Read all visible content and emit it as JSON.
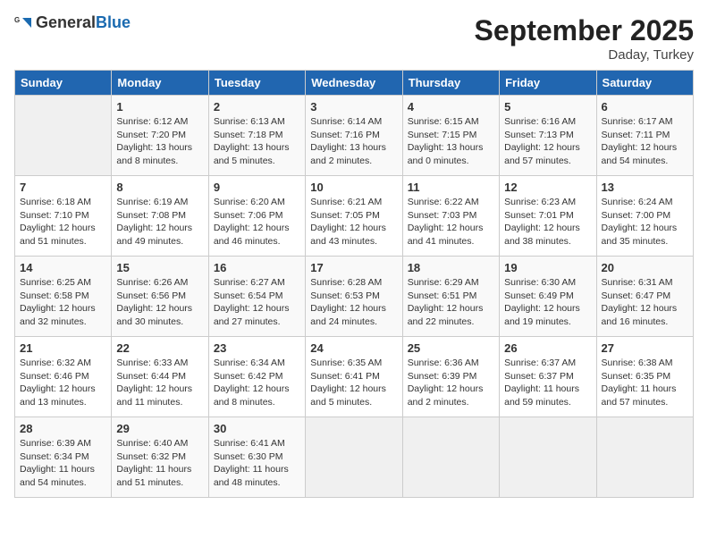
{
  "header": {
    "logo_general": "General",
    "logo_blue": "Blue",
    "month": "September 2025",
    "location": "Daday, Turkey"
  },
  "days": [
    "Sunday",
    "Monday",
    "Tuesday",
    "Wednesday",
    "Thursday",
    "Friday",
    "Saturday"
  ],
  "weeks": [
    [
      {
        "date": "",
        "info": ""
      },
      {
        "date": "1",
        "info": "Sunrise: 6:12 AM\nSunset: 7:20 PM\nDaylight: 13 hours\nand 8 minutes."
      },
      {
        "date": "2",
        "info": "Sunrise: 6:13 AM\nSunset: 7:18 PM\nDaylight: 13 hours\nand 5 minutes."
      },
      {
        "date": "3",
        "info": "Sunrise: 6:14 AM\nSunset: 7:16 PM\nDaylight: 13 hours\nand 2 minutes."
      },
      {
        "date": "4",
        "info": "Sunrise: 6:15 AM\nSunset: 7:15 PM\nDaylight: 13 hours\nand 0 minutes."
      },
      {
        "date": "5",
        "info": "Sunrise: 6:16 AM\nSunset: 7:13 PM\nDaylight: 12 hours\nand 57 minutes."
      },
      {
        "date": "6",
        "info": "Sunrise: 6:17 AM\nSunset: 7:11 PM\nDaylight: 12 hours\nand 54 minutes."
      }
    ],
    [
      {
        "date": "7",
        "info": "Sunrise: 6:18 AM\nSunset: 7:10 PM\nDaylight: 12 hours\nand 51 minutes."
      },
      {
        "date": "8",
        "info": "Sunrise: 6:19 AM\nSunset: 7:08 PM\nDaylight: 12 hours\nand 49 minutes."
      },
      {
        "date": "9",
        "info": "Sunrise: 6:20 AM\nSunset: 7:06 PM\nDaylight: 12 hours\nand 46 minutes."
      },
      {
        "date": "10",
        "info": "Sunrise: 6:21 AM\nSunset: 7:05 PM\nDaylight: 12 hours\nand 43 minutes."
      },
      {
        "date": "11",
        "info": "Sunrise: 6:22 AM\nSunset: 7:03 PM\nDaylight: 12 hours\nand 41 minutes."
      },
      {
        "date": "12",
        "info": "Sunrise: 6:23 AM\nSunset: 7:01 PM\nDaylight: 12 hours\nand 38 minutes."
      },
      {
        "date": "13",
        "info": "Sunrise: 6:24 AM\nSunset: 7:00 PM\nDaylight: 12 hours\nand 35 minutes."
      }
    ],
    [
      {
        "date": "14",
        "info": "Sunrise: 6:25 AM\nSunset: 6:58 PM\nDaylight: 12 hours\nand 32 minutes."
      },
      {
        "date": "15",
        "info": "Sunrise: 6:26 AM\nSunset: 6:56 PM\nDaylight: 12 hours\nand 30 minutes."
      },
      {
        "date": "16",
        "info": "Sunrise: 6:27 AM\nSunset: 6:54 PM\nDaylight: 12 hours\nand 27 minutes."
      },
      {
        "date": "17",
        "info": "Sunrise: 6:28 AM\nSunset: 6:53 PM\nDaylight: 12 hours\nand 24 minutes."
      },
      {
        "date": "18",
        "info": "Sunrise: 6:29 AM\nSunset: 6:51 PM\nDaylight: 12 hours\nand 22 minutes."
      },
      {
        "date": "19",
        "info": "Sunrise: 6:30 AM\nSunset: 6:49 PM\nDaylight: 12 hours\nand 19 minutes."
      },
      {
        "date": "20",
        "info": "Sunrise: 6:31 AM\nSunset: 6:47 PM\nDaylight: 12 hours\nand 16 minutes."
      }
    ],
    [
      {
        "date": "21",
        "info": "Sunrise: 6:32 AM\nSunset: 6:46 PM\nDaylight: 12 hours\nand 13 minutes."
      },
      {
        "date": "22",
        "info": "Sunrise: 6:33 AM\nSunset: 6:44 PM\nDaylight: 12 hours\nand 11 minutes."
      },
      {
        "date": "23",
        "info": "Sunrise: 6:34 AM\nSunset: 6:42 PM\nDaylight: 12 hours\nand 8 minutes."
      },
      {
        "date": "24",
        "info": "Sunrise: 6:35 AM\nSunset: 6:41 PM\nDaylight: 12 hours\nand 5 minutes."
      },
      {
        "date": "25",
        "info": "Sunrise: 6:36 AM\nSunset: 6:39 PM\nDaylight: 12 hours\nand 2 minutes."
      },
      {
        "date": "26",
        "info": "Sunrise: 6:37 AM\nSunset: 6:37 PM\nDaylight: 11 hours\nand 59 minutes."
      },
      {
        "date": "27",
        "info": "Sunrise: 6:38 AM\nSunset: 6:35 PM\nDaylight: 11 hours\nand 57 minutes."
      }
    ],
    [
      {
        "date": "28",
        "info": "Sunrise: 6:39 AM\nSunset: 6:34 PM\nDaylight: 11 hours\nand 54 minutes."
      },
      {
        "date": "29",
        "info": "Sunrise: 6:40 AM\nSunset: 6:32 PM\nDaylight: 11 hours\nand 51 minutes."
      },
      {
        "date": "30",
        "info": "Sunrise: 6:41 AM\nSunset: 6:30 PM\nDaylight: 11 hours\nand 48 minutes."
      },
      {
        "date": "",
        "info": ""
      },
      {
        "date": "",
        "info": ""
      },
      {
        "date": "",
        "info": ""
      },
      {
        "date": "",
        "info": ""
      }
    ]
  ]
}
